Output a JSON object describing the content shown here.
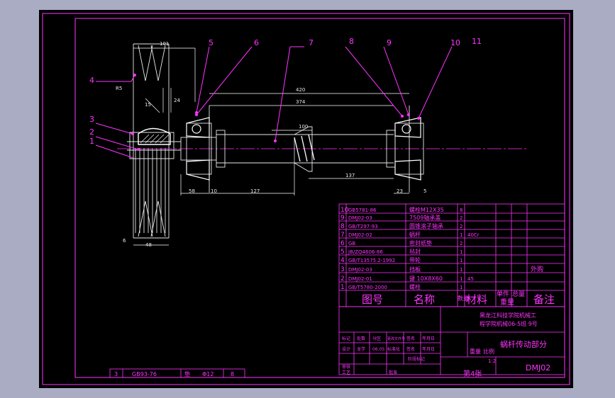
{
  "balloons": [
    "1",
    "2",
    "3",
    "4",
    "5",
    "6",
    "7",
    "8",
    "9",
    "10",
    "11"
  ],
  "dimensions": {
    "d101": "101",
    "r85": "R5",
    "d15": "15",
    "d24": "24",
    "d420": "420",
    "d374": "374",
    "d100": "100",
    "d137": "137",
    "d58": "58",
    "d10": "10",
    "d127": "127",
    "d23": "23",
    "d5": "5",
    "d6": "6",
    "d48": "48"
  },
  "bom": {
    "rows": [
      {
        "no": "10",
        "code": "GB5781-86",
        "name": "螺栓M12X35",
        "qty": "8",
        "material": "",
        "note": ""
      },
      {
        "no": "9",
        "code": "DMJ02-03",
        "name": "7509轴承盖",
        "qty": "2",
        "material": "",
        "note": ""
      },
      {
        "no": "8",
        "code": "GB/T297-93",
        "name": "圆锥滚子轴承",
        "qty": "2",
        "material": "",
        "note": ""
      },
      {
        "no": "7",
        "code": "DMJ02-02",
        "name": "蜗杆",
        "qty": "1",
        "material": "40Cr",
        "note": ""
      },
      {
        "no": "6",
        "code": "GB",
        "name": "密封纸垫",
        "qty": "2",
        "material": "",
        "note": ""
      },
      {
        "no": "5",
        "code": "JB/ZQ4606-86",
        "name": "毡封",
        "qty": "1",
        "material": "",
        "note": ""
      },
      {
        "no": "4",
        "code": "GB/T13575.2-1992",
        "name": "带轮",
        "qty": "1",
        "material": "",
        "note": ""
      },
      {
        "no": "3",
        "code": "DMJ02-03",
        "name": "挡板",
        "qty": "1",
        "material": "",
        "note": "外购"
      },
      {
        "no": "2",
        "code": "DMJ02-01",
        "name": "键 10X8X60",
        "qty": "1",
        "material": "45",
        "note": ""
      },
      {
        "no": "1",
        "code": "GB/T5780-2000",
        "name": "螺栓",
        "qty": "1",
        "material": "",
        "note": ""
      }
    ],
    "header": {
      "code": "图号",
      "name": "名称",
      "qty": "数量",
      "material": "材料",
      "unit_weight": "单件",
      "total_weight": "总量",
      "weight": "重量",
      "note": "备注"
    }
  },
  "title_block": {
    "org_line1": "黑龙江科技学院机械工",
    "org_line2": "程学院机械06-5班 9号",
    "drawing_title": "蜗杆传动部分",
    "drawing_no": "DMJ02",
    "scale": "1:2",
    "sheet": "第4张",
    "weight_label": "重量",
    "scale_label": "比例",
    "mark_label": "标记",
    "count_label": "处数",
    "zone_label": "分区",
    "change_doc_label": "更改文件号",
    "sign_label": "签名",
    "date_label": "年月日",
    "design_label": "设计",
    "design_name": "龙学",
    "design_date": "06.05",
    "standard_label": "标准化",
    "stage_label": "阶段标记",
    "review_label": "审核",
    "process_label": "工艺",
    "approve_label": "批准"
  },
  "extra_row": {
    "no": "3",
    "code": "GB93-76",
    "name": "垫",
    "spec": "Φ12",
    "qty": "8"
  }
}
